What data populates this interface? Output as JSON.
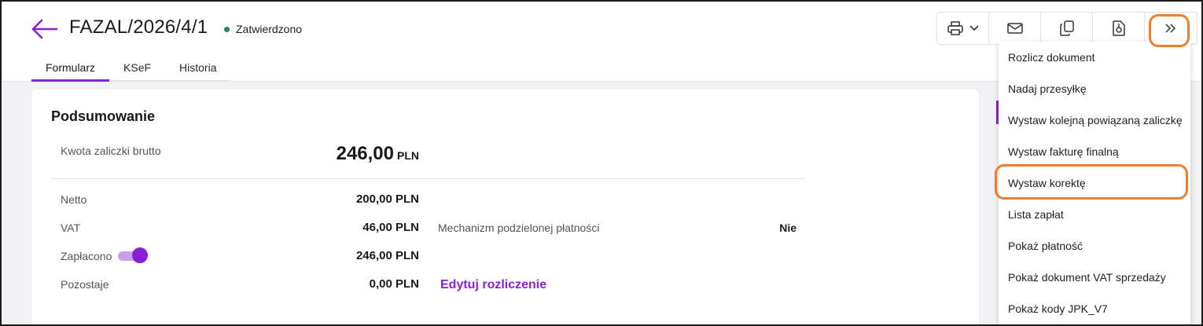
{
  "header": {
    "title": "FAZAL/2026/4/1",
    "status": "Zatwierdzono",
    "status_color": "#1f8a5b",
    "back_icon": "arrow-left-icon"
  },
  "tabs": [
    {
      "label": "Formularz",
      "active": true
    },
    {
      "label": "KSeF",
      "active": false
    },
    {
      "label": "Historia",
      "active": false
    }
  ],
  "toolbar": {
    "icons": [
      "printer-icon",
      "chevron-down-icon",
      "mail-icon",
      "copy-icon",
      "pdf-file-icon",
      "double-chevron-right-icon"
    ]
  },
  "summary": {
    "title": "Podsumowanie",
    "gross_label": "Kwota zaliczki brutto",
    "gross_value": "246,00",
    "gross_currency": "PLN",
    "net_label": "Netto",
    "net_value": "200,00 PLN",
    "vat_label": "VAT",
    "vat_value": "46,00 PLN",
    "split_payment_label": "Mechanizm podzielonej płatności",
    "split_payment_value": "Nie",
    "paid_label": "Zapłacono",
    "paid_toggle_on": true,
    "paid_value": "246,00 PLN",
    "remaining_label": "Pozostaje",
    "remaining_value": "0,00 PLN",
    "edit_link": "Edytuj rozliczenie"
  },
  "menu": {
    "items": [
      "Rozlicz dokument",
      "Nadaj przesyłkę",
      "Wystaw kolejną powiązaną zaliczkę",
      "Wystaw fakturę finalną",
      "Wystaw korektę",
      "Lista zapłat",
      "Pokaż płatność",
      "Pokaż dokument VAT sprzedaży",
      "Pokaż kody JPK_V7"
    ],
    "highlighted": "Wystaw korektę"
  },
  "colors": {
    "accent": "#8a1fd6",
    "highlight": "#f07d2b"
  }
}
